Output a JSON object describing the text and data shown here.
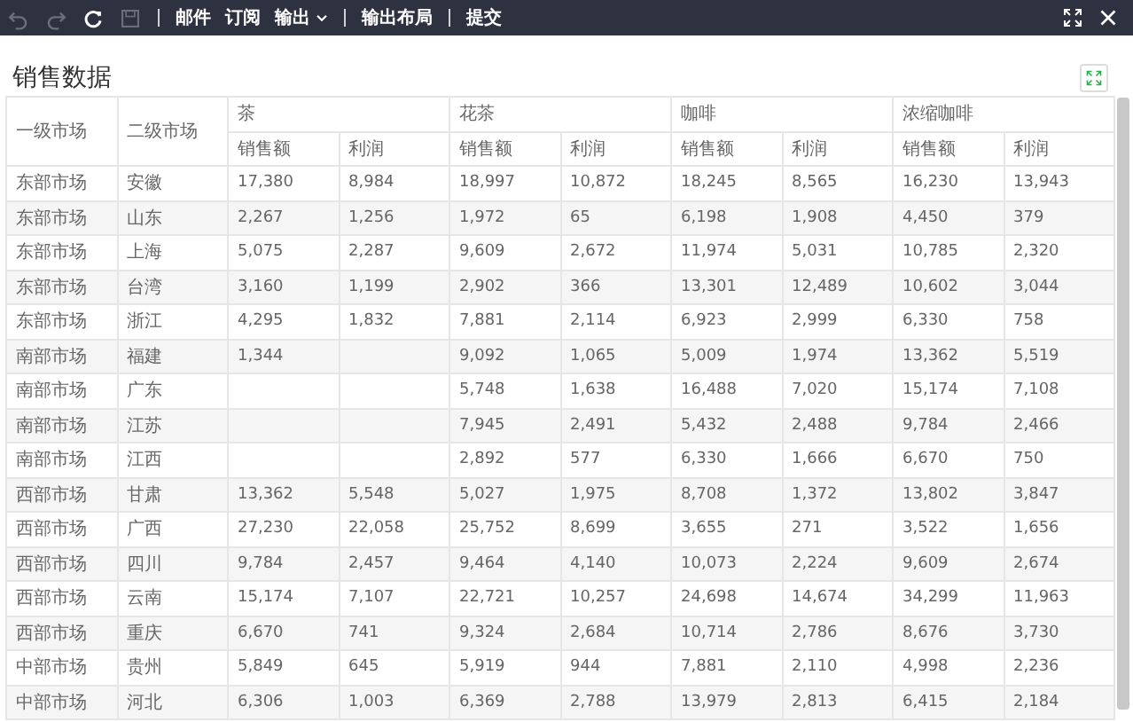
{
  "toolbar": {
    "items": [
      {
        "kind": "icon",
        "disabled": true
      },
      {
        "kind": "icon",
        "disabled": true
      },
      {
        "kind": "icon",
        "disabled": false
      },
      {
        "kind": "icon",
        "disabled": true
      },
      {
        "kind": "separator"
      },
      {
        "kind": "text",
        "label": "邮件"
      },
      {
        "kind": "text",
        "label": "订阅"
      },
      {
        "kind": "menu",
        "label": "输出"
      },
      {
        "kind": "separator"
      },
      {
        "kind": "text",
        "label": "输出布局"
      },
      {
        "kind": "separator"
      },
      {
        "kind": "text",
        "label": "提交"
      }
    ]
  },
  "report": {
    "title": "销售数据",
    "table": {
      "columns": [
        "一级市场",
        "二级市场"
      ],
      "groups": [
        {
          "label": "茶",
          "sub": [
            "销售额",
            "利润"
          ]
        },
        {
          "label": "花茶",
          "sub": [
            "销售额",
            "利润"
          ]
        },
        {
          "label": "咖啡",
          "sub": [
            "销售额",
            "利润"
          ]
        },
        {
          "label": "浓缩咖啡",
          "sub": [
            "销售额",
            "利润"
          ]
        }
      ],
      "rows": [
        {
          "region": "东部市场",
          "province": "安徽",
          "tea_sales": "17,380",
          "tea_profit": "8,984",
          "flower_sales": "18,997",
          "flower_profit": "10,872",
          "coffee_sales": "18,245",
          "coffee_profit": "8,565",
          "espresso_sales": "16,230",
          "espresso_profit": "13,943"
        },
        {
          "region": "东部市场",
          "province": "山东",
          "tea_sales": "2,267",
          "tea_profit": "1,256",
          "flower_sales": "1,972",
          "flower_profit": "65",
          "coffee_sales": "6,198",
          "coffee_profit": "1,908",
          "espresso_sales": "4,450",
          "espresso_profit": "379"
        },
        {
          "region": "东部市场",
          "province": "上海",
          "tea_sales": "5,075",
          "tea_profit": "2,287",
          "flower_sales": "9,609",
          "flower_profit": "2,672",
          "coffee_sales": "11,974",
          "coffee_profit": "5,031",
          "espresso_sales": "10,785",
          "espresso_profit": "2,320"
        },
        {
          "region": "东部市场",
          "province": "台湾",
          "tea_sales": "3,160",
          "tea_profit": "1,199",
          "flower_sales": "2,902",
          "flower_profit": "366",
          "coffee_sales": "13,301",
          "coffee_profit": "12,489",
          "espresso_sales": "10,602",
          "espresso_profit": "3,044"
        },
        {
          "region": "东部市场",
          "province": "浙江",
          "tea_sales": "4,295",
          "tea_profit": "1,832",
          "flower_sales": "7,881",
          "flower_profit": "2,114",
          "coffee_sales": "6,923",
          "coffee_profit": "2,999",
          "espresso_sales": "6,330",
          "espresso_profit": "758"
        },
        {
          "region": "南部市场",
          "province": "福建",
          "tea_sales": "1,344",
          "flower_sales": "9,092",
          "flower_profit": "1,065",
          "coffee_sales": "5,009",
          "coffee_profit": "1,974",
          "espresso_sales": "13,362",
          "espresso_profit": "5,519"
        },
        {
          "region": "南部市场",
          "province": "广东",
          "flower_sales": "5,748",
          "flower_profit": "1,638",
          "coffee_sales": "16,488",
          "coffee_profit": "7,020",
          "espresso_sales": "15,174",
          "espresso_profit": "7,108"
        },
        {
          "region": "南部市场",
          "province": "江苏",
          "flower_sales": "7,945",
          "flower_profit": "2,491",
          "coffee_sales": "5,432",
          "coffee_profit": "2,488",
          "espresso_sales": "9,784",
          "espresso_profit": "2,466"
        },
        {
          "region": "南部市场",
          "province": "江西",
          "flower_sales": "2,892",
          "flower_profit": "577",
          "coffee_sales": "6,330",
          "coffee_profit": "1,666",
          "espresso_sales": "6,670",
          "espresso_profit": "750"
        },
        {
          "region": "西部市场",
          "province": "甘肃",
          "tea_sales": "13,362",
          "tea_profit": "5,548",
          "flower_sales": "5,027",
          "flower_profit": "1,975",
          "coffee_sales": "8,708",
          "coffee_profit": "1,372",
          "espresso_sales": "13,802",
          "espresso_profit": "3,847"
        },
        {
          "region": "西部市场",
          "province": "广西",
          "tea_sales": "27,230",
          "tea_profit": "22,058",
          "flower_sales": "25,752",
          "flower_profit": "8,699",
          "coffee_sales": "3,655",
          "coffee_profit": "271",
          "espresso_sales": "3,522",
          "espresso_profit": "1,656"
        },
        {
          "region": "西部市场",
          "province": "四川",
          "tea_sales": "9,784",
          "tea_profit": "2,457",
          "flower_sales": "9,464",
          "flower_profit": "4,140",
          "coffee_sales": "10,073",
          "coffee_profit": "2,224",
          "espresso_sales": "9,609",
          "espresso_profit": "2,674"
        },
        {
          "region": "西部市场",
          "province": "云南",
          "tea_sales": "15,174",
          "tea_profit": "7,107",
          "flower_sales": "22,721",
          "flower_profit": "10,257",
          "coffee_sales": "24,698",
          "coffee_profit": "14,674",
          "espresso_sales": "34,299",
          "espresso_profit": "11,963"
        },
        {
          "region": "西部市场",
          "province": "重庆",
          "tea_sales": "6,670",
          "tea_profit": "741",
          "flower_sales": "9,324",
          "flower_profit": "2,684",
          "coffee_sales": "10,714",
          "coffee_profit": "2,786",
          "espresso_sales": "8,676",
          "espresso_profit": "3,730"
        },
        {
          "region": "中部市场",
          "province": "贵州",
          "tea_sales": "5,849",
          "tea_profit": "645",
          "flower_sales": "5,919",
          "flower_profit": "944",
          "coffee_sales": "7,881",
          "coffee_profit": "2,110",
          "espresso_sales": "4,998",
          "espresso_profit": "2,236"
        },
        {
          "region": "中部市场",
          "province": "河北",
          "tea_sales": "6,306",
          "tea_profit": "1,003",
          "flower_sales": "6,369",
          "flower_profit": "2,788",
          "coffee_sales": "13,979",
          "coffee_profit": "2,813",
          "espresso_sales": "6,415",
          "espresso_profit": "2,184"
        }
      ]
    }
  }
}
